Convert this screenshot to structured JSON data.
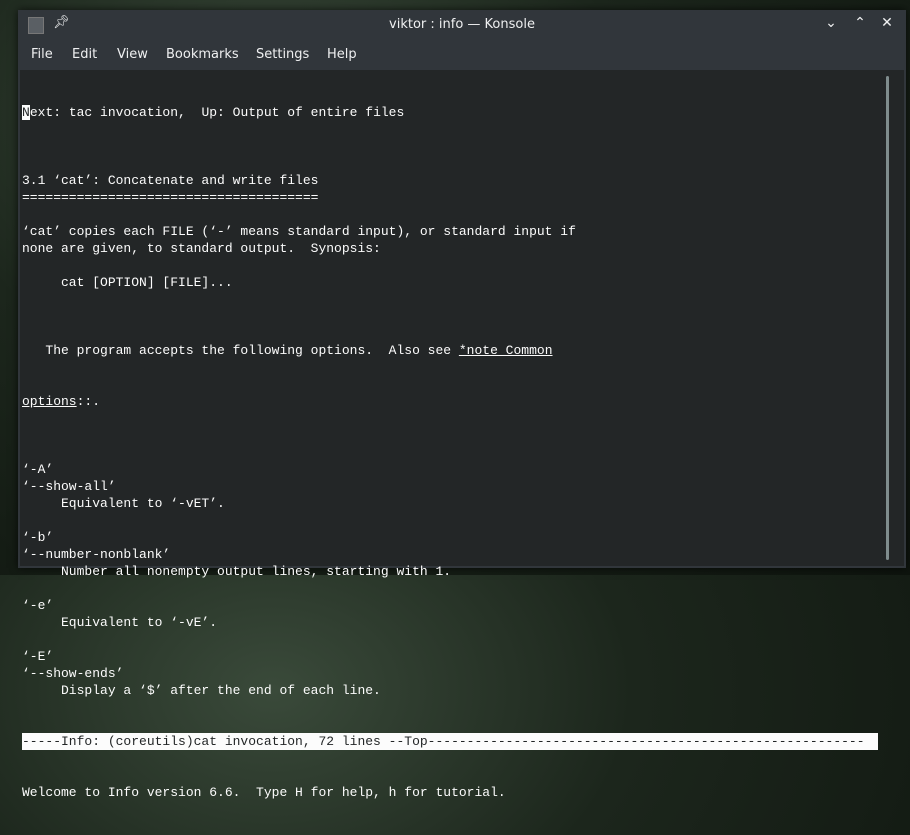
{
  "window": {
    "title": "viktor : info — Konsole"
  },
  "menu": [
    "File",
    "Edit",
    "View",
    "Bookmarks",
    "Settings",
    "Help"
  ],
  "terminal": {
    "cursor_char": "N",
    "line0_rest": "ext: tac invocation,  Up: Output of entire files",
    "lines": [
      "",
      "3.1 ‘cat’: Concatenate and write files",
      "======================================",
      "",
      "‘cat’ copies each FILE (‘-’ means standard input), or standard input if",
      "none are given, to standard output.  Synopsis:",
      "",
      "     cat [OPTION] [FILE]...",
      ""
    ],
    "line10_pre": "   The program accepts the following options.  Also see ",
    "line10_link": "*note Common",
    "line11_link": "options",
    "line11_post": "::.",
    "lines2": [
      "",
      "‘-A’",
      "‘--show-all’",
      "     Equivalent to ‘-vET’.",
      "",
      "‘-b’",
      "‘--number-nonblank’",
      "     Number all nonempty output lines, starting with 1.",
      "",
      "‘-e’",
      "     Equivalent to ‘-vE’.",
      "",
      "‘-E’",
      "‘--show-ends’",
      "     Display a ‘$’ after the end of each line."
    ],
    "status_line": "-----Info: (coreutils)cat invocation, 72 lines --Top--------------------------------------------------------",
    "echo_line": "Welcome to Info version 6.6.  Type H for help, h for tutorial."
  }
}
